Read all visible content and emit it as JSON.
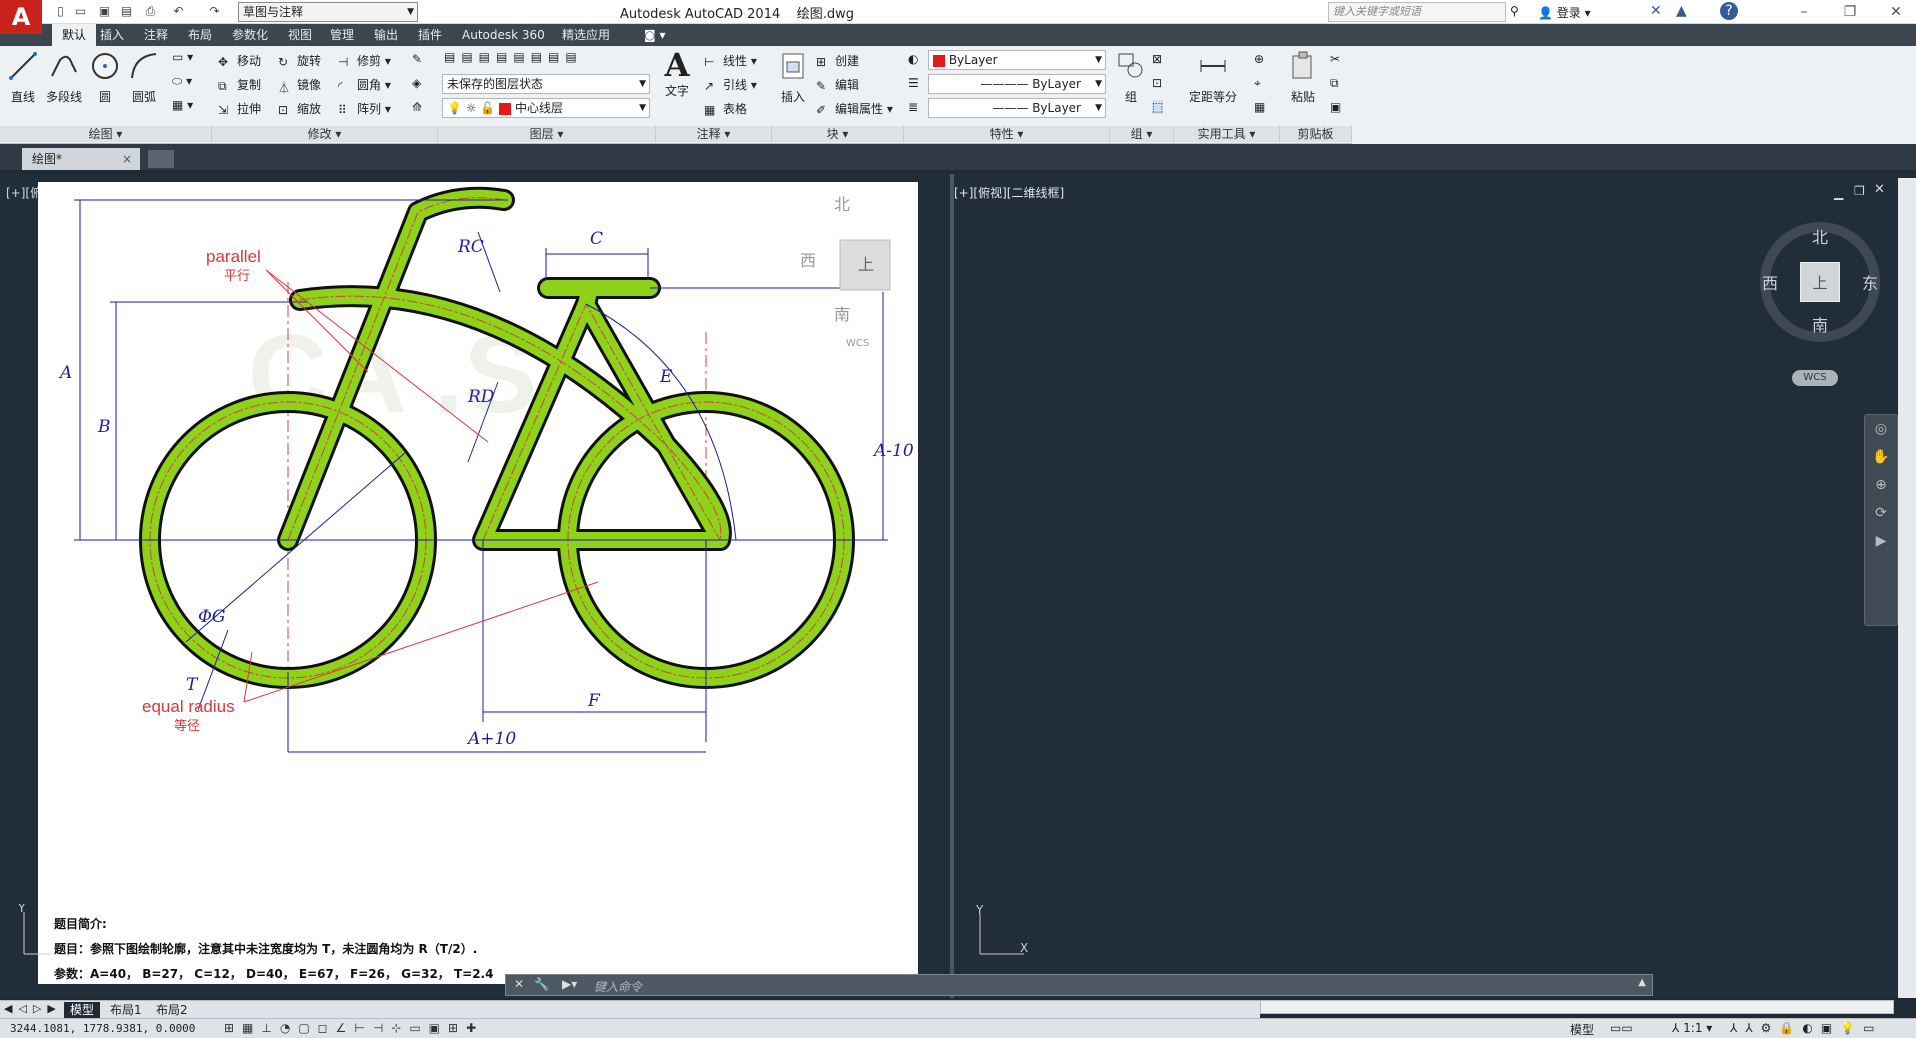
{
  "app": {
    "title": "Autodesk AutoCAD 2014",
    "file": "绘图.dwg",
    "workspace": "草图与注释",
    "search_placeholder": "键入关键字或短语",
    "login": "登录"
  },
  "menu_tabs": [
    "默认",
    "插入",
    "注释",
    "布局",
    "参数化",
    "视图",
    "管理",
    "输出",
    "插件",
    "Autodesk 360",
    "精选应用"
  ],
  "ribbon": {
    "draw": {
      "title": "绘图",
      "line": "直线",
      "polyline": "多段线",
      "circle": "圆",
      "arc": "圆弧"
    },
    "modify": {
      "title": "修改",
      "move": "移动",
      "rotate": "旋转",
      "trim": "修剪",
      "copy": "复制",
      "mirror": "镜像",
      "fillet": "圆角",
      "stretch": "拉伸",
      "scale": "缩放",
      "array": "阵列"
    },
    "layers": {
      "title": "图层",
      "state": "未保存的图层状态",
      "current": "中心线层"
    },
    "annotation": {
      "title": "注释",
      "text": "文字",
      "linear": "线性",
      "leader": "引线",
      "table": "表格"
    },
    "block": {
      "title": "块",
      "insert": "插入",
      "create": "创建",
      "edit": "编辑",
      "edit_attr": "编辑属性"
    },
    "properties": {
      "title": "特性",
      "color": "ByLayer",
      "linetype": "ByLayer",
      "lineweight": "ByLayer"
    },
    "groups": {
      "title": "组",
      "group": "组"
    },
    "utilities": {
      "title": "实用工具",
      "measure": "定距等分"
    },
    "clipboard": {
      "title": "剪贴板",
      "paste": "粘贴"
    }
  },
  "file_tab": "绘图*",
  "viewports": {
    "left_label": "[+][俯",
    "right_label": "[+][俯视][二维线框]"
  },
  "viewcube": {
    "north": "北",
    "south": "南",
    "west": "西",
    "east": "东",
    "top": "上",
    "wcs": "WCS"
  },
  "drawing": {
    "labels": {
      "parallel": "parallel",
      "parallel_cn": "平行",
      "equal_radius": "equal radius",
      "equal_radius_cn": "等径"
    },
    "dims": {
      "A": "A",
      "B": "B",
      "C": "C",
      "RC": "RC",
      "RD": "RD",
      "E": "E",
      "F": "F",
      "G": "ΦG",
      "T": "T",
      "A10v": "A-10",
      "A10h": "A+10"
    },
    "watermark": "CA  .S",
    "intro_title": "题目简介:",
    "intro_line1": "题目：参照下图绘制轮廓，注意其中未注宽度均为 T，未注圆角均为 R（T/2）.",
    "intro_line2": "参数：A=40，  B=27，  C=12，  D=40，  E=67，  F=26，  G=32，  T=2.4"
  },
  "command_placeholder": "键入命令",
  "layout_tabs": [
    "模型",
    "布局1",
    "布局2"
  ],
  "coords": "3244.1081, 1778.9381, 0.0000",
  "status": {
    "model": "模型",
    "scale": "1:1"
  },
  "colors": {
    "bike_fill": "#8fd219",
    "dimension": "#1d1d9e",
    "annotation": "#d63a3a",
    "background": "#212d39"
  }
}
